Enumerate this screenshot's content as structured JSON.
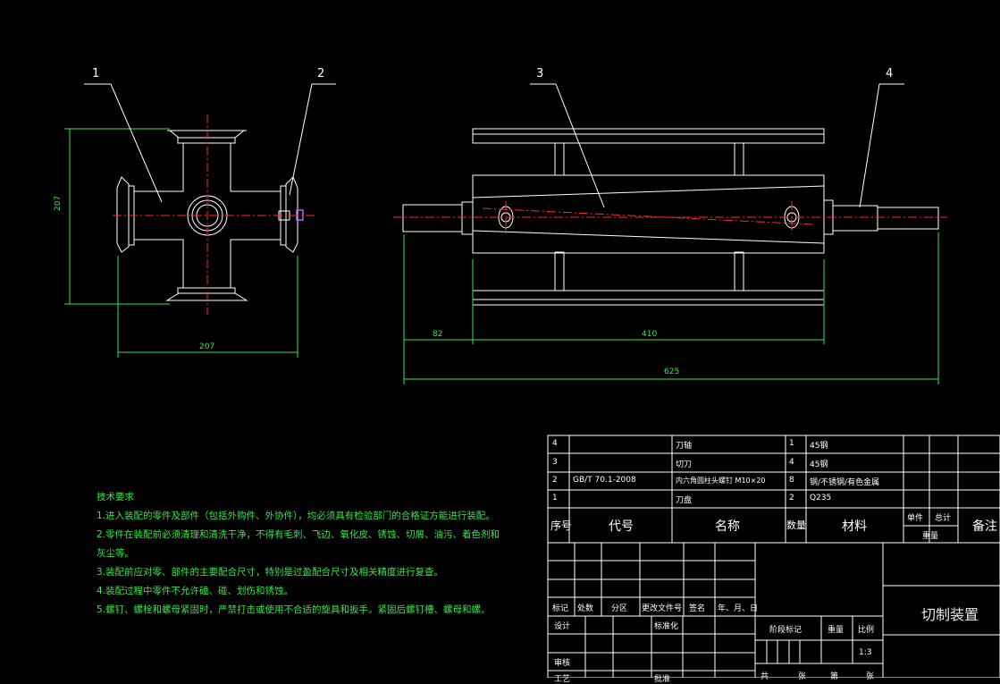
{
  "colors": {
    "background": "#000000",
    "outline": "#ffffff",
    "centerline": "#ff2a2a",
    "dimension": "#37e64a",
    "bolt": "#c060ff"
  },
  "balloons": [
    "1",
    "2",
    "3",
    "4"
  ],
  "dimensions": {
    "side_height": "207",
    "side_width": "207",
    "shaft_left": "82",
    "roller_length": "410",
    "overall_length": "625"
  },
  "technical_requirements": {
    "title": "技术要求",
    "items": [
      "1.进入装配的零件及部件（包括外购件、外协件），均必须具有检验部门的合格证方能进行装配。",
      "2.零件在装配前必须清理和清洗干净，不得有毛刺、飞边、氧化皮、锈蚀、切屑、油污、着色剂和",
      "灰尘等。",
      "3.装配前应对零、部件的主要配合尺寸，特别是过盈配合尺寸及相关精度进行复查。",
      "4.装配过程中零件不允许磕、碰、划伤和锈蚀。",
      "5.螺钉、螺栓和螺母紧固时，严禁打击或使用不合适的旋具和扳手。紧固后螺钉槽、螺母和螺。"
    ]
  },
  "bom": {
    "rows": [
      {
        "no": "4",
        "code": "",
        "name": "刀轴",
        "qty": "1",
        "material": "45钢"
      },
      {
        "no": "3",
        "code": "",
        "name": "切刀",
        "qty": "4",
        "material": "45钢"
      },
      {
        "no": "2",
        "code": "GB/T 70.1-2008",
        "name": "内六角圆柱头螺钉 M10×20",
        "qty": "8",
        "material": "钢/不锈钢/有色金属"
      },
      {
        "no": "1",
        "code": "",
        "name": "刀盘",
        "qty": "2",
        "material": "Q235"
      }
    ],
    "header": {
      "no": "序号",
      "code": "代号",
      "name": "名称",
      "qty": "数量",
      "material": "材料",
      "single": "单件",
      "total": "总计",
      "weight": "重量",
      "remark": "备注"
    }
  },
  "title_block": {
    "drawing_name": "切制装置",
    "revision_labels": [
      "标记",
      "处数",
      "分区",
      "更改文件号",
      "签名",
      "年、月、日"
    ],
    "design": "设计",
    "standardize": "标准化",
    "review": "审核",
    "stage_mark": "阶段标记",
    "weight": "重量",
    "scale_label": "比例",
    "scale": "1:3",
    "process": "工艺",
    "approve": "批准",
    "sheet_labels": [
      "共",
      "张",
      "第",
      "张"
    ]
  }
}
